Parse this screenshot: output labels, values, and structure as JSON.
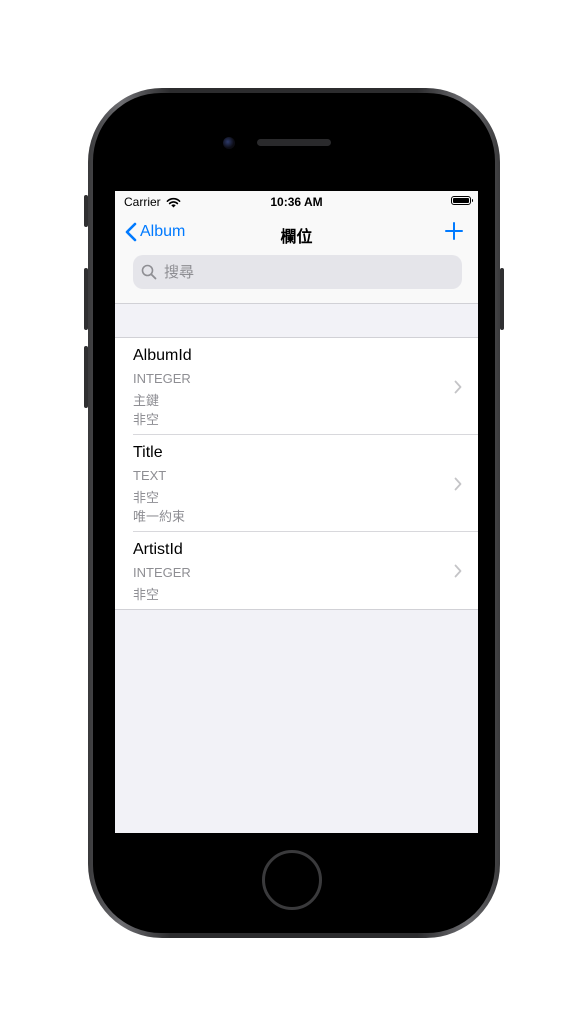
{
  "status_bar": {
    "carrier": "Carrier",
    "time": "10:36 AM"
  },
  "nav": {
    "back_label": "Album",
    "title": "欄位"
  },
  "search": {
    "placeholder": "搜尋",
    "value": ""
  },
  "columns": [
    {
      "name": "AlbumId",
      "type": "INTEGER",
      "attributes": [
        "主鍵",
        "非空"
      ]
    },
    {
      "name": "Title",
      "type": "TEXT",
      "attributes": [
        "非空",
        "唯一約束"
      ]
    },
    {
      "name": "ArtistId",
      "type": "INTEGER",
      "attributes": [
        "非空"
      ]
    }
  ],
  "colors": {
    "accent": "#007aff",
    "background": "#f2f2f7",
    "secondary_text": "#8e8e93"
  },
  "icons": [
    "chevron-left-icon",
    "plus-icon",
    "search-icon",
    "wifi-icon",
    "battery-icon",
    "chevron-right-icon"
  ]
}
